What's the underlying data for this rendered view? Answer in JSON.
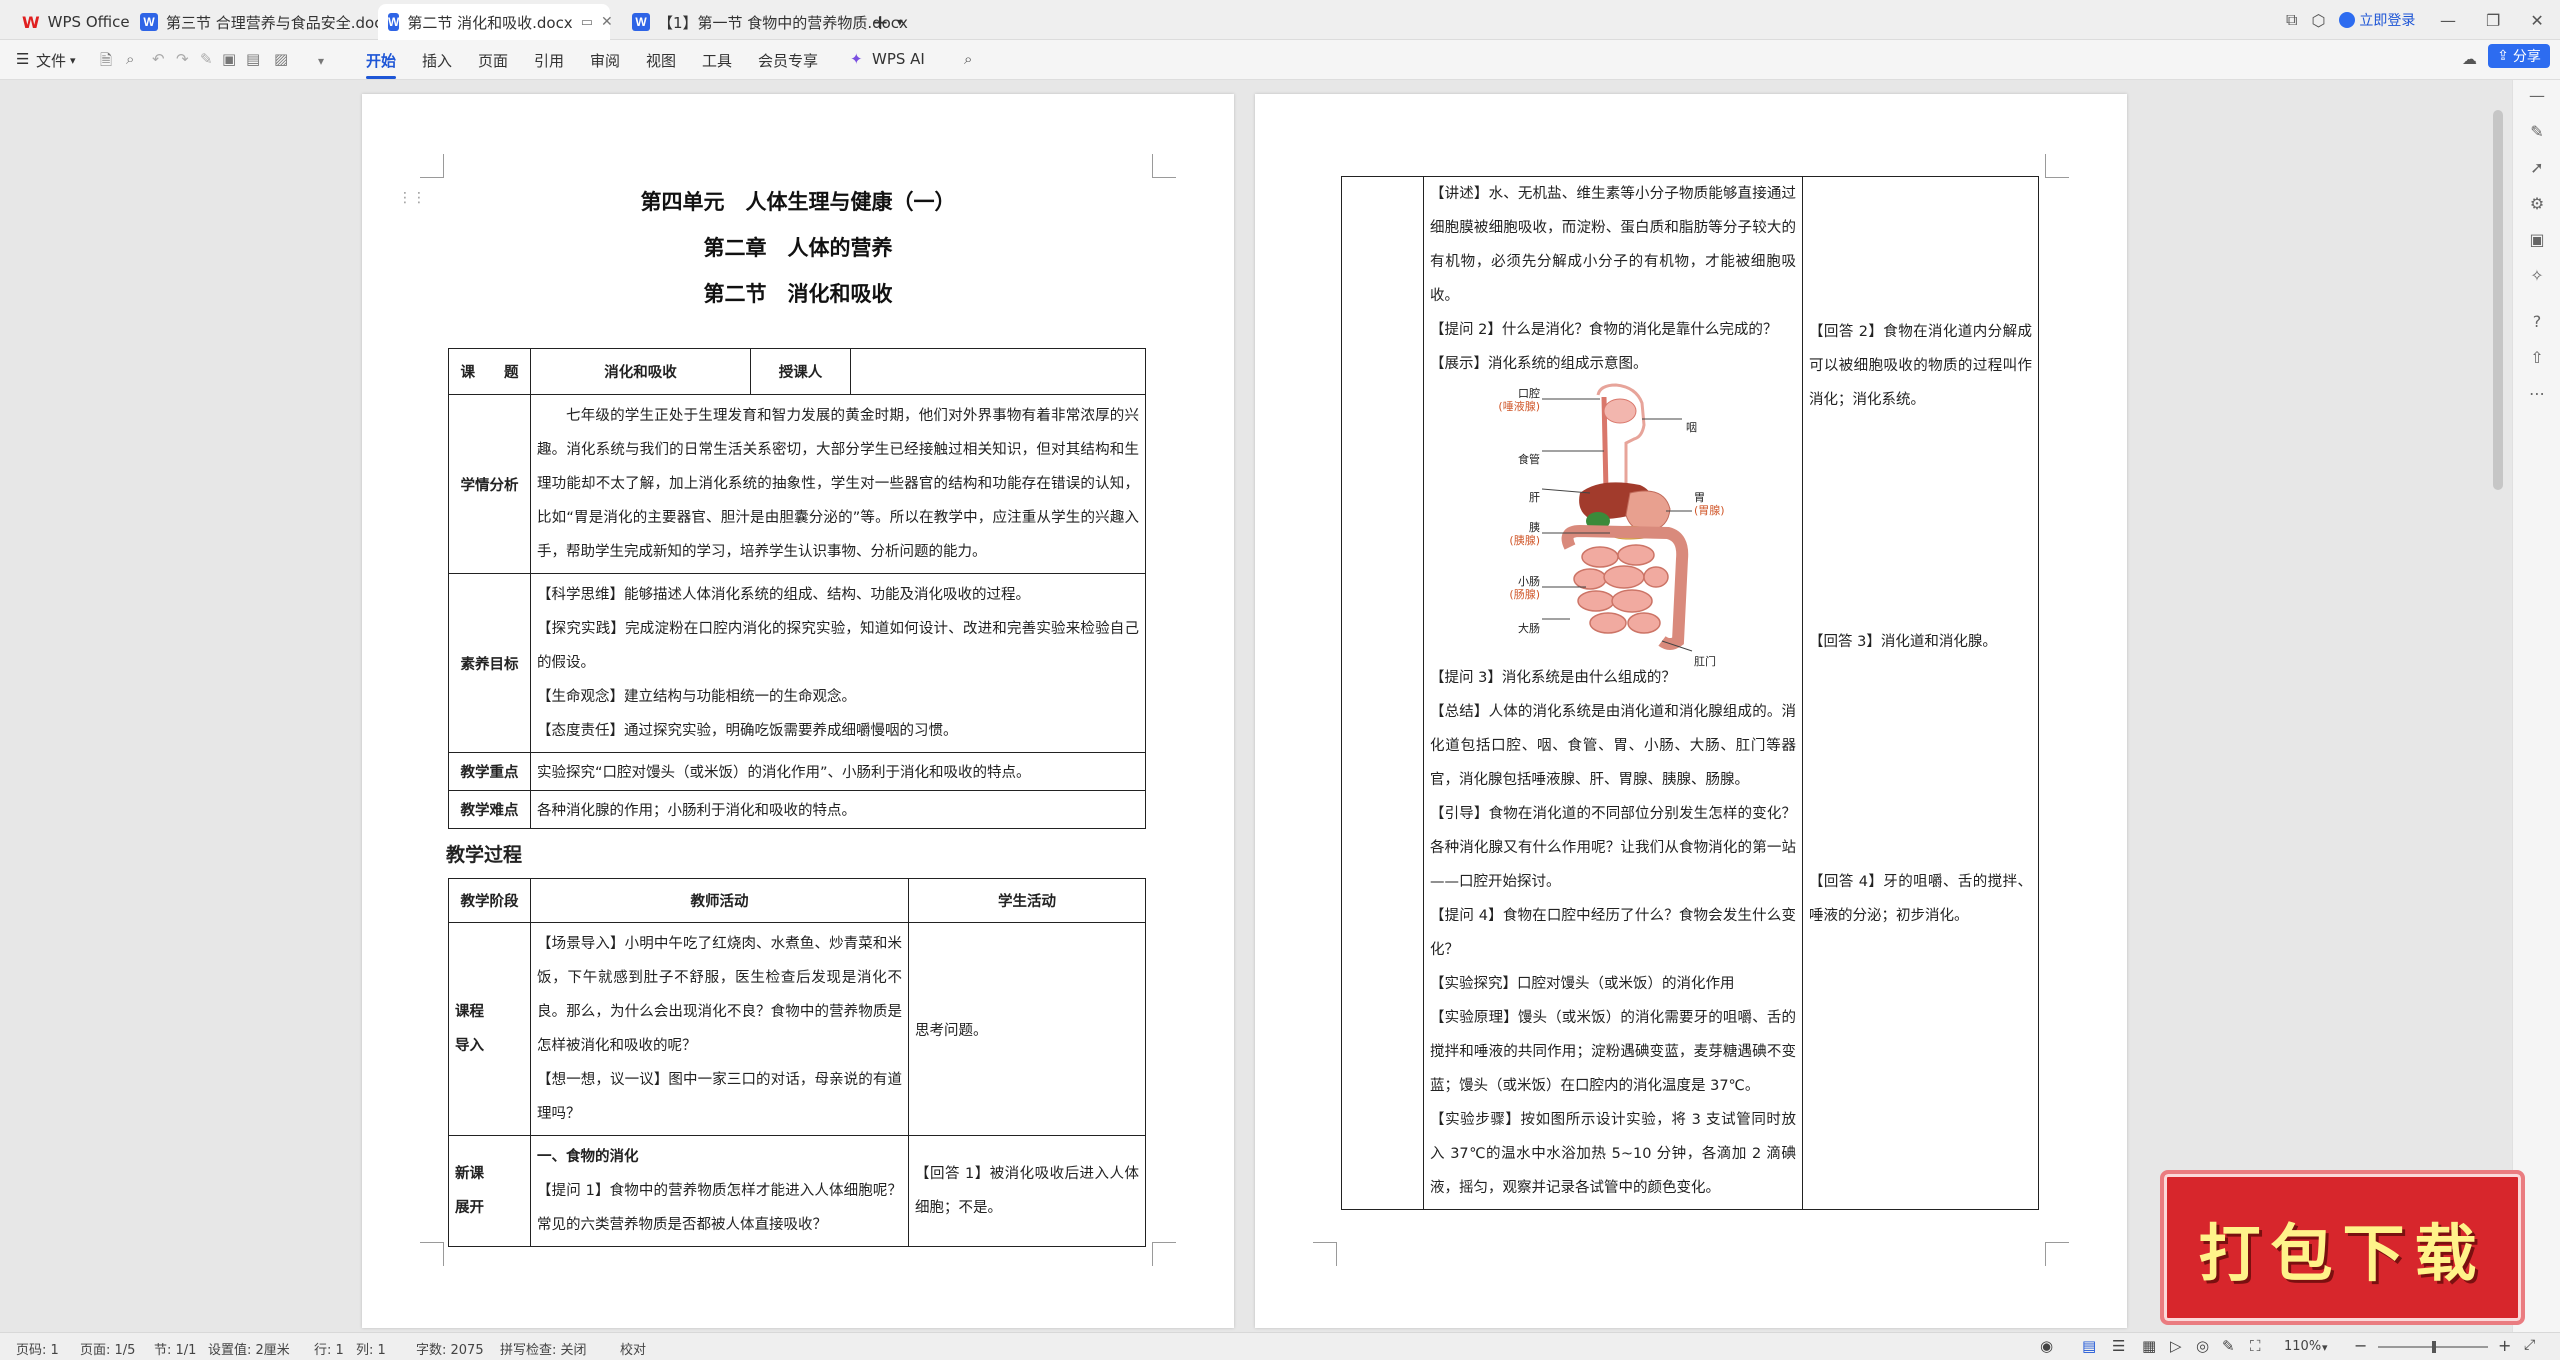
{
  "tabs": [
    {
      "label": "WPS Office"
    },
    {
      "label": "第三节  合理营养与食品安全.docx"
    },
    {
      "label": "第二节  消化和吸收.docx"
    },
    {
      "label": "【1】第一节  食物中的营养物质.docx"
    }
  ],
  "titlebar": {
    "login": "立即登录"
  },
  "menu": {
    "file": "文件",
    "items": [
      "开始",
      "插入",
      "页面",
      "引用",
      "审阅",
      "视图",
      "工具",
      "会员专享"
    ],
    "ai": "WPS AI",
    "share": "分享"
  },
  "doc": {
    "title1": "第四单元　人体生理与健康（一）",
    "title2": "第二章　人体的营养",
    "title3": "第二节　消化和吸收",
    "info": {
      "topic_label": "课　　题",
      "topic": "消化和吸收",
      "teacher_label": "授课人",
      "teacher": "",
      "xq_label": "学情分析",
      "xq_text": "七年级的学生正处于生理发育和智力发展的黄金时期，他们对外界事物有着非常浓厚的兴趣。消化系统与我们的日常生活关系密切，大部分学生已经接触过相关知识，但对其结构和生理功能却不太了解，加上消化系统的抽象性，学生对一些器官的结构和功能存在错误的认知，比如“胃是消化的主要器官、胆汁是由胆囊分泌的”等。所以在教学中，应注重从学生的兴趣入手，帮助学生完成新知的学习，培养学生认识事物、分析问题的能力。",
      "sy_label": "素养目标",
      "sy": [
        "【科学思维】能够描述人体消化系统的组成、结构、功能及消化吸收的过程。",
        "【探究实践】完成淀粉在口腔内消化的探究实验，知道如何设计、改进和完善实验来检验自己的假设。",
        "【生命观念】建立结构与功能相统一的生命观念。",
        "【态度责任】通过探究实验，明确吃饭需要养成细嚼慢咽的习惯。"
      ],
      "zd_label": "教学重点",
      "zd": "实验探究“口腔对馒头（或米饭）的消化作用”、小肠利于消化和吸收的特点。",
      "nd_label": "教学难点",
      "nd": "各种消化腺的作用；小肠利于消化和吸收的特点。"
    },
    "process_title": "教学过程",
    "process": {
      "h1": "教学阶段",
      "h2": "教师活动",
      "h3": "学生活动",
      "r1_stage_a": "课程",
      "r1_stage_b": "导入",
      "r1_t1": "【场景导入】小明中午吃了红烧肉、水煮鱼、炒青菜和米饭，下午就感到肚子不舒服，医生检查后发现是消化不良。那么，为什么会出现消化不良？食物中的营养物质是怎样被消化和吸收的呢？",
      "r1_t2": "【想一想，议一议】图中一家三口的对话，母亲说的有道理吗？",
      "r1_s": "思考问题。",
      "r2_stage_a": "新课",
      "r2_stage_b": "展开",
      "r2_t_head": "一、食物的消化",
      "r2_t1": "【提问 1】食物中的营养物质怎样才能进入人体细胞呢？常见的六类营养物质是否都被人体直接吸收？",
      "r2_s": "【回答 1】被消化吸收后进入人体细胞；不是。"
    },
    "page2": {
      "t1": "【讲述】水、无机盐、维生素等小分子物质能够直接通过细胞膜被细胞吸收，而淀粉、蛋白质和脂肪等分子较大的有机物，必须先分解成小分子的有机物，才能被细胞吸收。",
      "t2": "【提问 2】什么是消化？食物的消化是靠什么完成的？",
      "t3": "【展示】消化系统的组成示意图。",
      "t4": "【提问 3】消化系统是由什么组成的？",
      "t5": "【总结】人体的消化系统是由消化道和消化腺组成的。消化道包括口腔、咽、食管、胃、小肠、大肠、肛门等器官，消化腺包括唾液腺、肝、胃腺、胰腺、肠腺。",
      "t6": "【引导】食物在消化道的不同部位分别发生怎样的变化？各种消化腺又有什么作用呢？让我们从食物消化的第一站——口腔开始探讨。",
      "t7": "【提问 4】食物在口腔中经历了什么？食物会发生什么变化？",
      "t8": "【实验探究】口腔对馒头（或米饭）的消化作用",
      "t9": "【实验原理】馒头（或米饭）的消化需要牙的咀嚼、舌的搅拌和唾液的共同作用；淀粉遇碘变蓝，麦芽糖遇碘不变蓝；馒头（或米饭）在口腔内的消化温度是 37℃。",
      "t10": "【实验步骤】按如图所示设计实验，将 3 支试管同时放入 37℃的温水中水浴加热 5~10 分钟，各滴加 2 滴碘液，摇匀，观察并记录各试管中的颜色变化。",
      "s2": "【回答 2】食物在消化道内分解成可以被细胞吸收的物质的过程叫作消化；消化系统。",
      "s3": "【回答 3】消化道和消化腺。",
      "s4": "【回答 4】牙的咀嚼、舌的搅拌、唾液的分泌；初步消化。",
      "diagram_labels": {
        "mouth": "口腔",
        "saliva": "(唾液腺)",
        "pharynx": "咽",
        "esophagus": "食管",
        "liver": "肝",
        "stomach": "胃",
        "gastric": "(胃腺)",
        "pancreas": "胰",
        "pancreas_gland": "(胰腺)",
        "small": "小肠",
        "intestinal": "(肠腺)",
        "large": "大肠",
        "anus": "肛门"
      }
    }
  },
  "status": {
    "page": "页码: 1",
    "pages": "页面: 1/5",
    "section": "节: 1/1",
    "setting": "设置值: 2厘米",
    "row": "行: 1",
    "col": "列: 1",
    "words": "字数: 2075",
    "spell": "拼写检查: 关闭",
    "proof": "校对",
    "zoom": "110%"
  },
  "badge": "打包下载",
  "colors": {
    "accent": "#1e56d6",
    "badge": "#d7262c"
  }
}
